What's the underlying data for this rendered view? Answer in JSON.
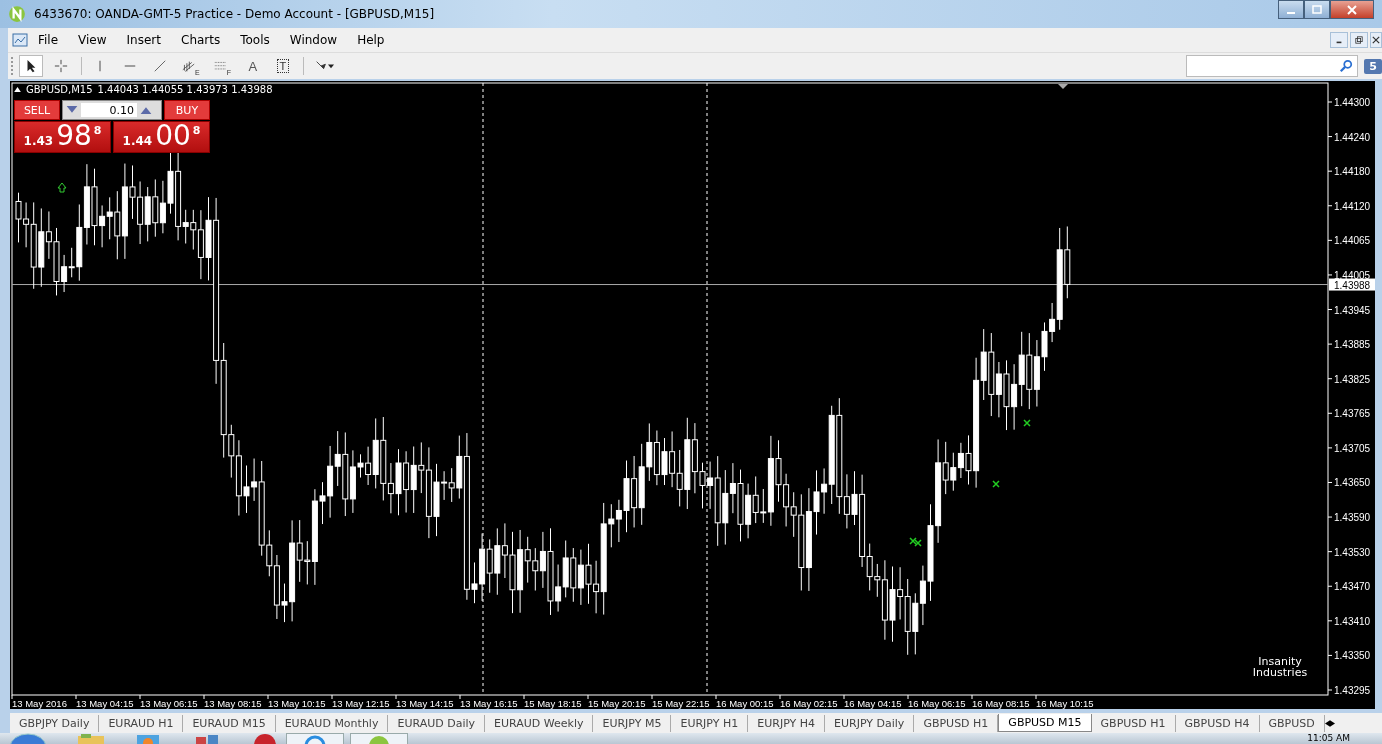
{
  "window": {
    "title": "6433670: OANDA-GMT-5 Practice - Demo Account - [GBPUSD,M15]"
  },
  "menu": [
    "File",
    "View",
    "Insert",
    "Charts",
    "Tools",
    "Window",
    "Help"
  ],
  "toolbar": [
    {
      "kind": "cursor",
      "selected": true
    },
    {
      "kind": "crosshair",
      "selected": false
    },
    {
      "kind": "vline",
      "selected": false
    },
    {
      "kind": "hline",
      "selected": false
    },
    {
      "kind": "trend",
      "selected": false
    },
    {
      "kind": "channel",
      "label": "E",
      "selected": false
    },
    {
      "kind": "fibo",
      "label": "F",
      "selected": false
    },
    {
      "kind": "text",
      "label": "A",
      "selected": false
    },
    {
      "kind": "textlabel",
      "label": "T",
      "selected": false
    },
    {
      "kind": "shapes",
      "selected": false
    }
  ],
  "notifications": "5",
  "chart": {
    "symbol": "GBPUSD,M15",
    "ohlc": "1.44043 1.44055 1.43973 1.43988",
    "yticks": [
      "1.44300",
      "1.44240",
      "1.44180",
      "1.44120",
      "1.44065",
      "1.44005",
      "1.43945",
      "1.43885",
      "1.43825",
      "1.43765",
      "1.43705",
      "1.43650",
      "1.43590",
      "1.43530",
      "1.43470",
      "1.43410",
      "1.43350",
      "1.43295"
    ],
    "current_price": "1.43988",
    "xticks": [
      "13 May 2016",
      "13 May 04:15",
      "13 May 06:15",
      "13 May 08:15",
      "13 May 10:15",
      "13 May 12:15",
      "13 May 14:15",
      "13 May 16:15",
      "15 May 18:15",
      "15 May 20:15",
      "15 May 22:15",
      "16 May 00:15",
      "16 May 02:15",
      "16 May 04:15",
      "16 May 06:15",
      "16 May 08:15",
      "16 May 10:15"
    ],
    "logo_text": [
      "Insanity",
      "Industries"
    ]
  },
  "trade": {
    "sell_label": "SELL",
    "buy_label": "BUY",
    "volume": "0.10",
    "bid": {
      "big": "1.43",
      "pips": "98",
      "point": "8"
    },
    "ask": {
      "big": "1.44",
      "pips": "00",
      "point": "8"
    }
  },
  "tabs": [
    {
      "label": "GBPJPY Daily",
      "selected": false
    },
    {
      "label": "EURAUD H1",
      "selected": false
    },
    {
      "label": "EURAUD M15",
      "selected": false
    },
    {
      "label": "EURAUD Monthly",
      "selected": false
    },
    {
      "label": "EURAUD Daily",
      "selected": false
    },
    {
      "label": "EURAUD Weekly",
      "selected": false
    },
    {
      "label": "EURJPY M5",
      "selected": false
    },
    {
      "label": "EURJPY H1",
      "selected": false
    },
    {
      "label": "EURJPY H4",
      "selected": false
    },
    {
      "label": "EURJPY Daily",
      "selected": false
    },
    {
      "label": "GBPUSD H1",
      "selected": false
    },
    {
      "label": "GBPUSD M15",
      "selected": true
    },
    {
      "label": "GBPUSD H1",
      "selected": false
    },
    {
      "label": "GBPUSD H4",
      "selected": false
    },
    {
      "label": "GBPUSD",
      "selected": false
    }
  ],
  "taskbar": {
    "clock": "11:05 AM"
  }
}
